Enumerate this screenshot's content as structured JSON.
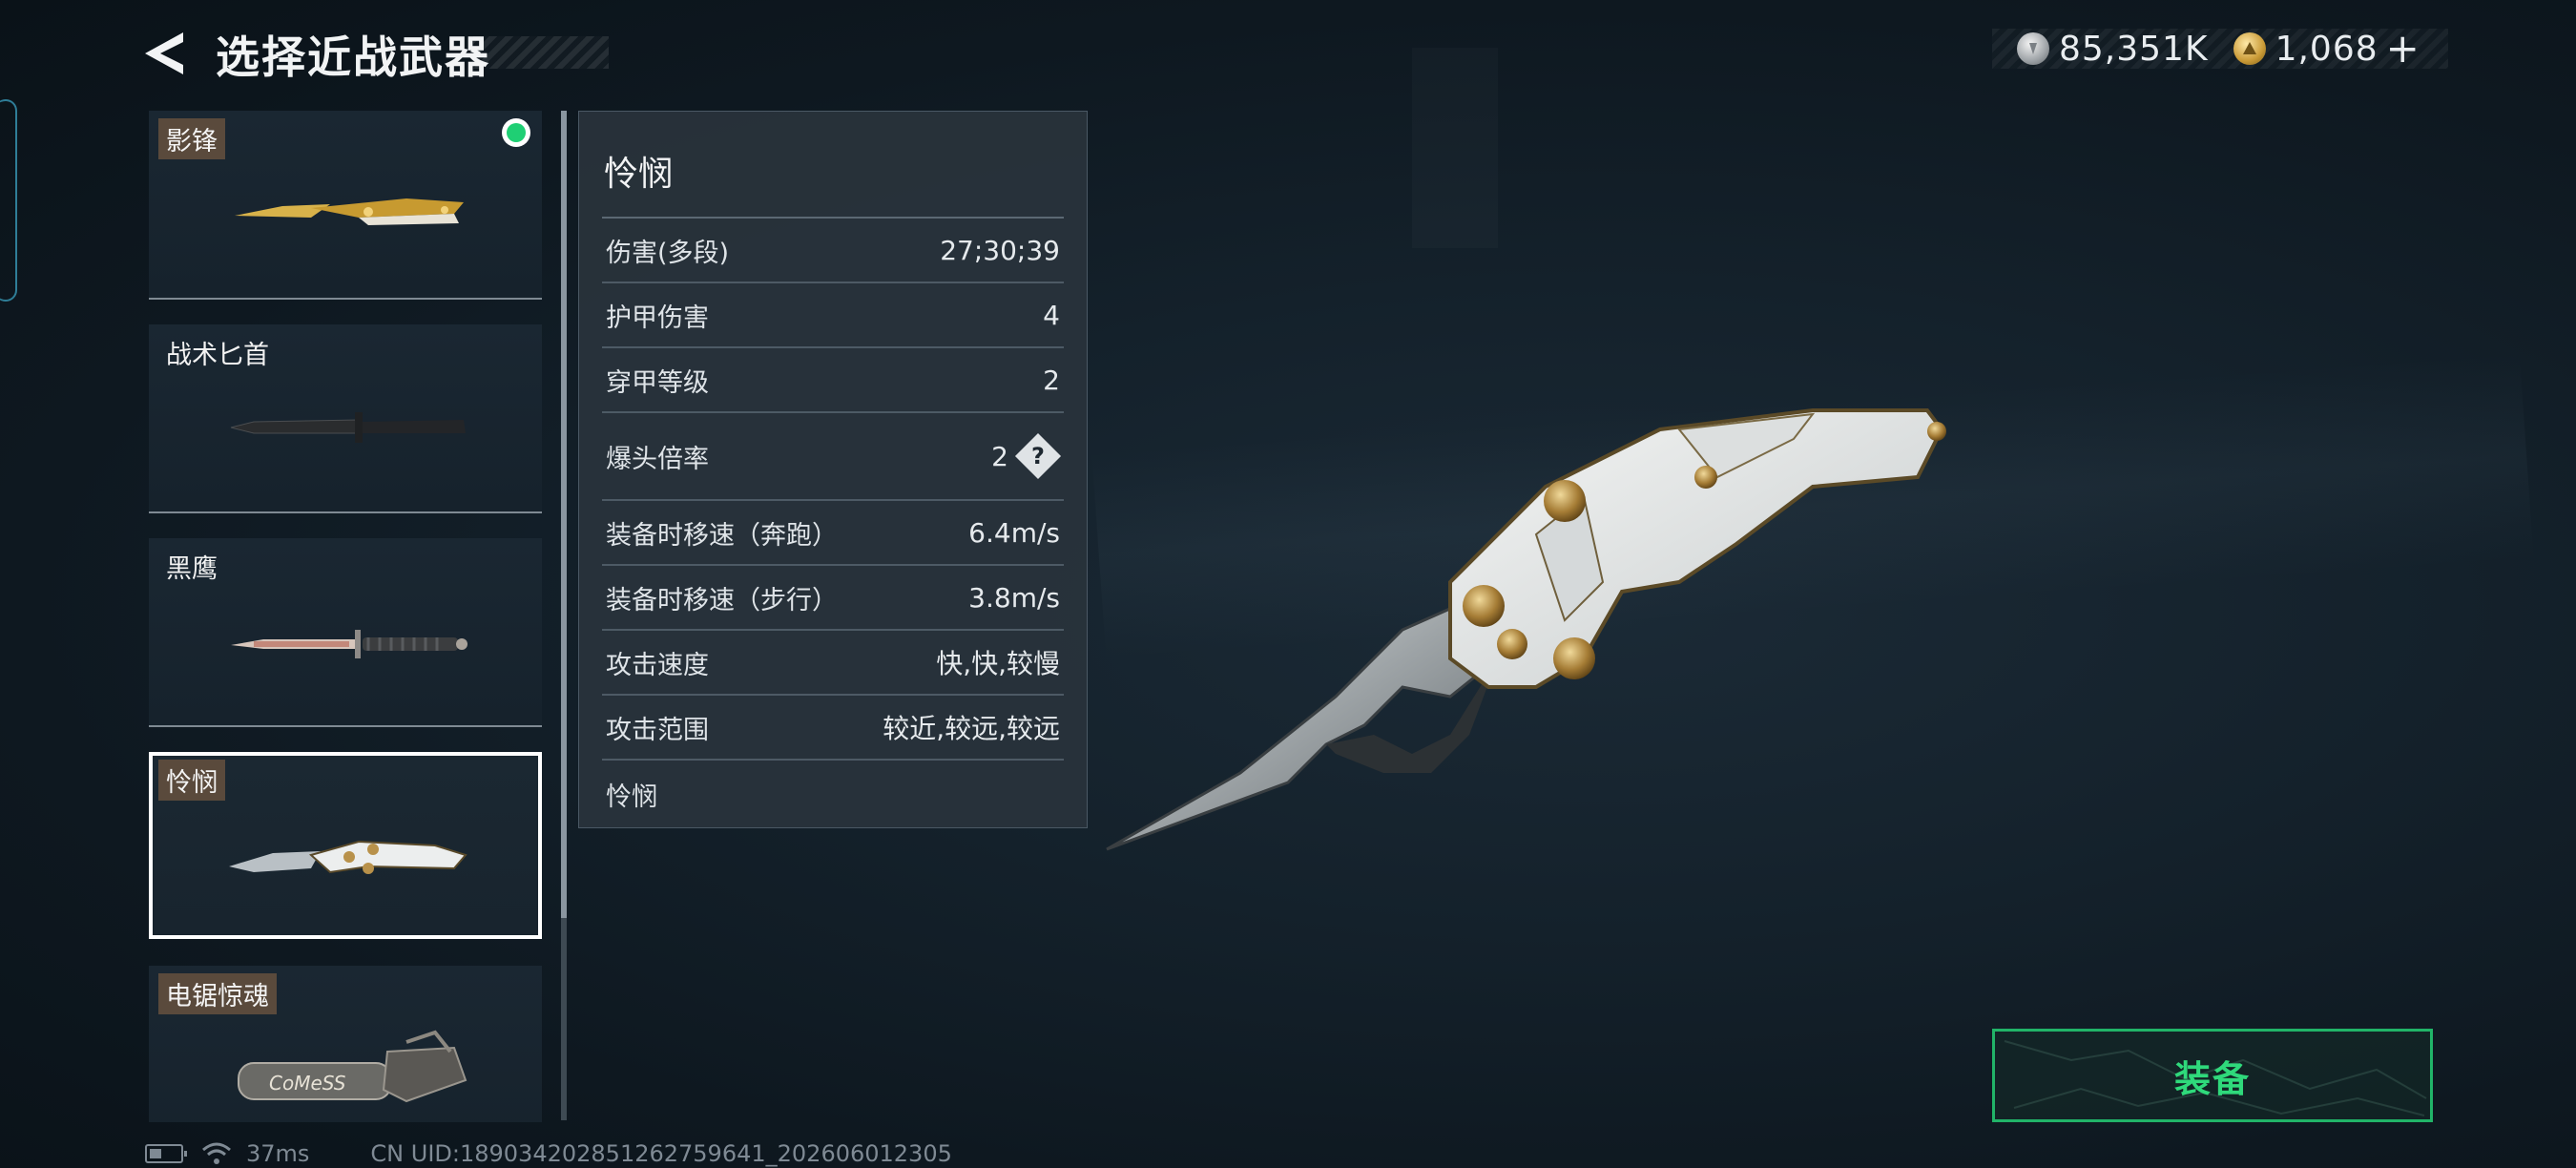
{
  "header": {
    "title": "选择近战武器",
    "back_icon": "back-arrow-icon"
  },
  "currency": {
    "silver_amount": "85,351K",
    "gold_amount": "1,068",
    "plus": "+",
    "silver_icon": "silver-coin-icon",
    "gold_icon": "gold-coin-icon"
  },
  "weapons": [
    {
      "name": "影锋",
      "equipped": true,
      "selected": false
    },
    {
      "name": "战术匕首",
      "equipped": false,
      "selected": false
    },
    {
      "name": "黑鹰",
      "equipped": false,
      "selected": false
    },
    {
      "name": "怜悯",
      "equipped": false,
      "selected": true
    },
    {
      "name": "电锯惊魂",
      "equipped": false,
      "selected": false
    }
  ],
  "stats": {
    "title": "怜悯",
    "rows": [
      {
        "label": "伤害(多段)",
        "value": "27;30;39"
      },
      {
        "label": "护甲伤害",
        "value": "4"
      },
      {
        "label": "穿甲等级",
        "value": "2"
      },
      {
        "label": "爆头倍率",
        "value": "2",
        "help": "?"
      },
      {
        "label": "装备时移速（奔跑）",
        "value": "6.4m/s"
      },
      {
        "label": "装备时移速（步行）",
        "value": "3.8m/s"
      },
      {
        "label": "攻击速度",
        "value": "快,快,较慢"
      },
      {
        "label": "攻击范围",
        "value": "较近,较远,较远"
      }
    ],
    "footer": "怜悯"
  },
  "equip_button": {
    "label": "装备"
  },
  "status": {
    "ping": "37ms",
    "uid": "CN UID:18903420285126275​9641_202606012305"
  },
  "colors": {
    "accent_green": "#21b468",
    "equipped_green": "#1fcf74",
    "background": "#14212b"
  }
}
